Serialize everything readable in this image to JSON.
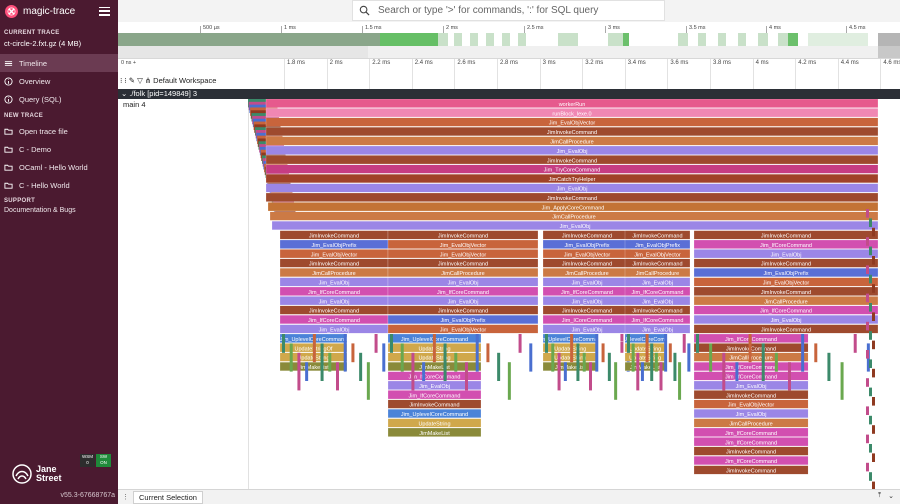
{
  "app": {
    "title": "magic-trace"
  },
  "sidebar": {
    "current_trace_title": "CURRENT TRACE",
    "trace_file": "ct-circle-2.fxt.gz (4 MB)",
    "items": [
      {
        "label": "Timeline",
        "icon": "timeline-icon",
        "active": true
      },
      {
        "label": "Overview",
        "icon": "info-icon"
      },
      {
        "label": "Query (SQL)",
        "icon": "database-icon"
      }
    ],
    "new_trace_title": "NEW TRACE",
    "new_items": [
      {
        "label": "Open trace file",
        "icon": "folder-icon"
      },
      {
        "label": "C - Demo",
        "icon": "folder-icon"
      },
      {
        "label": "OCaml - Hello World",
        "icon": "folder-icon"
      },
      {
        "label": "C - Hello World",
        "icon": "folder-icon"
      }
    ],
    "support_title": "SUPPORT",
    "docs_label": "Documentation & Bugs",
    "brand": "Jane Street",
    "brand_line1": "Jane",
    "brand_line2": "Street",
    "badges": [
      {
        "top": "WSM",
        "bottom": "0",
        "color": "#2d2d2d"
      },
      {
        "top": "SW",
        "bottom": "ON",
        "color": "#1f8a3a"
      }
    ],
    "version": "v55.3-67668767a"
  },
  "search": {
    "placeholder": "Search or type '>' for commands, ':' for SQL query",
    "value": ""
  },
  "overview": {
    "ticks": [
      "500 µs",
      "1 ms",
      "1.5 ms",
      "2 ms",
      "2.5 ms",
      "3 ms",
      "3.5 ms",
      "4 ms",
      "4.5 ms"
    ]
  },
  "timeline": {
    "zero_label": "0 ns +",
    "workspace": "Default Workspace",
    "ticks": [
      "1.8 ms",
      "2 ms",
      "2.2 ms",
      "2.4 ms",
      "2.6 ms",
      "2.8 ms",
      "3 ms",
      "3.2 ms",
      "3.4 ms",
      "3.6 ms",
      "3.8 ms",
      "4 ms",
      "4.2 ms",
      "4.4 ms",
      "4.6 ms"
    ]
  },
  "track": {
    "process": "./folk [pid=149849] 3",
    "thread": "main 4"
  },
  "flame": {
    "full_width": [
      "workerRun",
      "runBlock_lexe.0",
      "Jim_EvalObjVector",
      "JimInvokeCommand",
      "JimCallProcedure",
      "Jim_EvalObj",
      "JimInvokeCommand",
      "Jim_TryCoreCommand",
      "JimCatchTryHelper",
      "Jim_EvalObj",
      "JimInvokeCommand",
      "Jim_ApplyCoreCommand",
      "JimCallProcedure",
      "Jim_EvalObj"
    ],
    "columns": [
      [
        "JimInvokeCommand",
        "Jim_EvalObjPrefix",
        "Jim_EvalObjVector",
        "JimInvokeCommand",
        "JimCallProcedure",
        "Jim_EvalObj",
        "Jim_IfCoreCommand",
        "Jim_EvalObj",
        "JimInvokeCommand",
        "Jim_IfCoreCommand",
        "Jim_EvalObj",
        "Jim_UplevelCoreCommand",
        "UpdateStringOf",
        "UpdateString",
        "JimMakeList"
      ],
      [
        "JimInvokeCommand",
        "Jim_EvalObjVector",
        "Jim_EvalObjVector",
        "JimInvokeCommand",
        "JimCallProcedure",
        "Jim_EvalObj",
        "Jim_IfCoreCommand",
        "Jim_EvalObj",
        "JimInvokeCommand",
        "Jim_EvalObjPrefix",
        "Jim_EvalObjVector",
        "Jim_UplevelCoreCommand",
        "UpdateString",
        "UpdateString",
        "JimMakeList",
        "Jim_IfCoreCommand",
        "Jim_EvalObj",
        "Jim_IfCoreCommand",
        "JimInvokeCommand",
        "Jim_UplevelCoreCommand",
        "UpdateString",
        "JimMakeList"
      ],
      [
        "JimInvokeCommand",
        "Jim_EvalObjPrefix",
        "Jim_EvalObjVector",
        "JimInvokeCommand",
        "JimCallProcedure",
        "Jim_EvalObj",
        "Jim_IfCoreCommand",
        "Jim_EvalObj",
        "JimInvokeCommand",
        "Jim_ICoreCommand",
        "Jim_EvalObj",
        "Jim_UplevelCoreCommand",
        "UpdateString",
        "UpdateString",
        "JimMakeList"
      ],
      [
        "JimInvokeCommand",
        "Jim_EvalObjPrefix",
        "Jim_EvalObjVector",
        "JimInvokeCommand",
        "JimCallProcedure",
        "Jim_EvalObj",
        "Jim_IfCoreCommand",
        "Jim_EvalObj",
        "JimInvokeCommand",
        "Jim_IfCoreCommand",
        "Jim_EvalObj",
        "Jim_UplevelCoreCommand",
        "UpdateString",
        "UpdateString",
        "JimMakeList"
      ],
      [
        "JimInvokeCommand",
        "Jim_IfCoreCommand",
        "Jim_EvalObj",
        "JimInvokeCommand",
        "Jim_EvalObjPrefix",
        "Jim_EvalObjVector",
        "JimInvokeCommand",
        "JimCallProcedure",
        "Jim_IfCoreCommand",
        "Jim_EvalObj",
        "JimInvokeCommand",
        "Jim_IfCoreCommand",
        "JimInvokeCommand",
        "JimCallProcedure",
        "Jim_IfCoreCommand",
        "Jim_IfCoreCommand",
        "Jim_EvalObj",
        "JimInvokeCommand",
        "Jim_EvalObjVector",
        "Jim_EvalObj",
        "JimCallProcedure",
        "Jim_IfCoreCommand",
        "Jim_IfCoreCommand",
        "JimInvokeCommand",
        "Jim_IfCoreCommand",
        "JimInvokeCommand"
      ]
    ]
  },
  "bottom": {
    "tab": "Current Selection"
  }
}
